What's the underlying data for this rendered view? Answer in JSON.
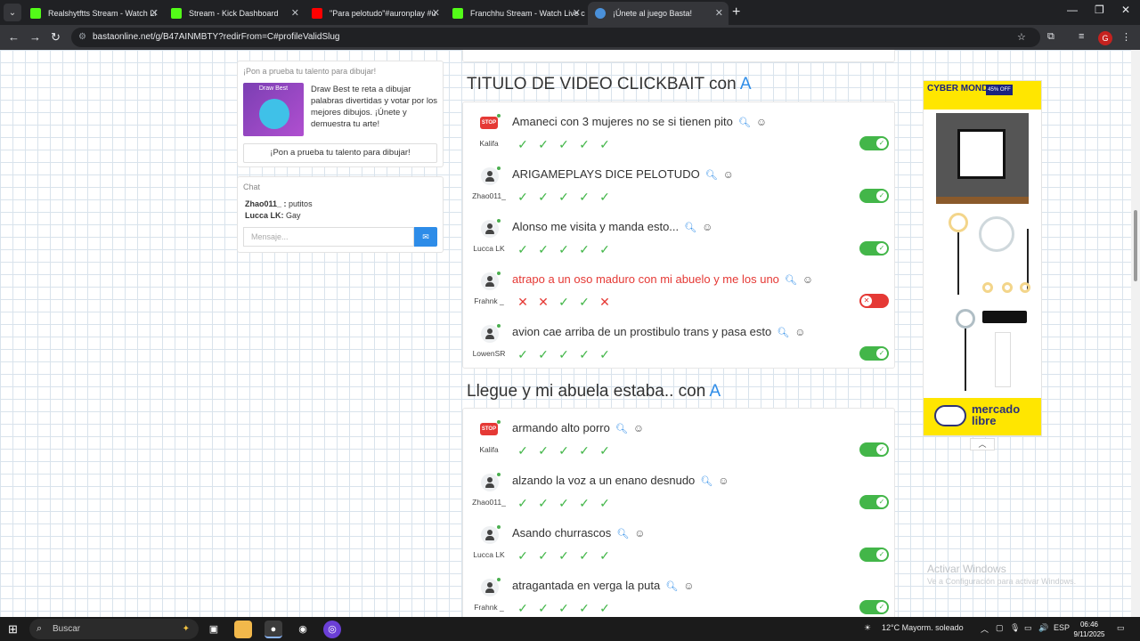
{
  "browser": {
    "tabs": [
      {
        "title": "Realshytftts Stream - Watch Li",
        "favicon_color": "#53fc18"
      },
      {
        "title": "Stream - Kick Dashboard",
        "favicon_color": "#53fc18"
      },
      {
        "title": "\"Para pelotudo\"#auronplay #u",
        "favicon_color": "#ff0000"
      },
      {
        "title": "Franchhu Stream - Watch Live c",
        "favicon_color": "#53fc18"
      },
      {
        "title": "¡Únete al juego Basta!",
        "favicon_color": "#4a90d9"
      }
    ],
    "active_tab": 4,
    "url": "bastaonline.net/g/B47AINMBTY?redirFrom=C#profileValidSlug",
    "profile_initial": "G"
  },
  "promo": {
    "title": "¡Pon a prueba tu talento para dibujar!",
    "image_label": "Draw Best",
    "description": "Draw Best te reta a dibujar palabras divertidas y votar por los mejores dibujos. ¡Únete y demuestra tu arte!",
    "button": "¡Pon a prueba tu talento para dibujar!"
  },
  "chat": {
    "title": "Chat",
    "messages": [
      {
        "user": "Zhao011_ :",
        "text": "putitos"
      },
      {
        "user": "Lucca LK:",
        "text": "Gay"
      }
    ],
    "input_placeholder": "Mensaje..."
  },
  "sections": [
    {
      "category": "TITULO DE VIDEO CLICKBAIT",
      "connector": "con",
      "letter": "A",
      "answers": [
        {
          "user": "Kalifa",
          "avatar": "stop",
          "text": "Amaneci con 3 mujeres no se si tienen pito",
          "votes": [
            "ok",
            "ok",
            "ok",
            "ok",
            "ok"
          ],
          "valid": true
        },
        {
          "user": "Zhao011_",
          "avatar": "generic",
          "text": "ARIGAMEPLAYS DICE PELOTUDO",
          "votes": [
            "ok",
            "ok",
            "ok",
            "ok",
            "ok"
          ],
          "valid": true
        },
        {
          "user": "Lucca LK",
          "avatar": "generic",
          "text": "Alonso me visita y manda esto...",
          "votes": [
            "ok",
            "ok",
            "ok",
            "ok",
            "ok"
          ],
          "valid": true
        },
        {
          "user": "Frahnk _",
          "avatar": "generic",
          "text": "atrapo a un oso maduro con mi abuelo y me los uno",
          "votes": [
            "no",
            "no",
            "ok",
            "ok",
            "no"
          ],
          "valid": false
        },
        {
          "user": "LowenSR",
          "avatar": "generic",
          "text": "avion cae arriba de un prostibulo trans y pasa esto",
          "votes": [
            "ok",
            "ok",
            "ok",
            "ok",
            "ok"
          ],
          "valid": true
        }
      ]
    },
    {
      "category": "Llegue y mi abuela estaba..",
      "connector": "con",
      "letter": "A",
      "answers": [
        {
          "user": "Kalifa",
          "avatar": "stop",
          "text": "armando alto porro",
          "votes": [
            "ok",
            "ok",
            "ok",
            "ok",
            "ok"
          ],
          "valid": true
        },
        {
          "user": "Zhao011_",
          "avatar": "generic",
          "text": "alzando la voz a un enano desnudo",
          "votes": [
            "ok",
            "ok",
            "ok",
            "ok",
            "ok"
          ],
          "valid": true
        },
        {
          "user": "Lucca LK",
          "avatar": "generic",
          "text": "Asando churrascos",
          "votes": [
            "ok",
            "ok",
            "ok",
            "ok",
            "ok"
          ],
          "valid": true
        },
        {
          "user": "Frahnk _",
          "avatar": "generic",
          "text": "atragantada en verga la puta",
          "votes": [
            "ok",
            "ok",
            "ok",
            "ok",
            "ok"
          ],
          "valid": true
        }
      ]
    }
  ],
  "ad": {
    "headline": "CYBER MONDAY",
    "badge": "45% OFF",
    "brand": "mercado libre"
  },
  "watermark": {
    "line1": "Activar Windows",
    "line2": "Ve a Configuración para activar Windows."
  },
  "taskbar": {
    "search_placeholder": "Buscar",
    "weather": "12°C  Mayorm. soleado",
    "language": "ESP",
    "time": "06:46",
    "date": "9/11/2025"
  },
  "colors": {
    "accent": "#2d8ce8",
    "valid": "#43b649",
    "invalid": "#e53935"
  }
}
